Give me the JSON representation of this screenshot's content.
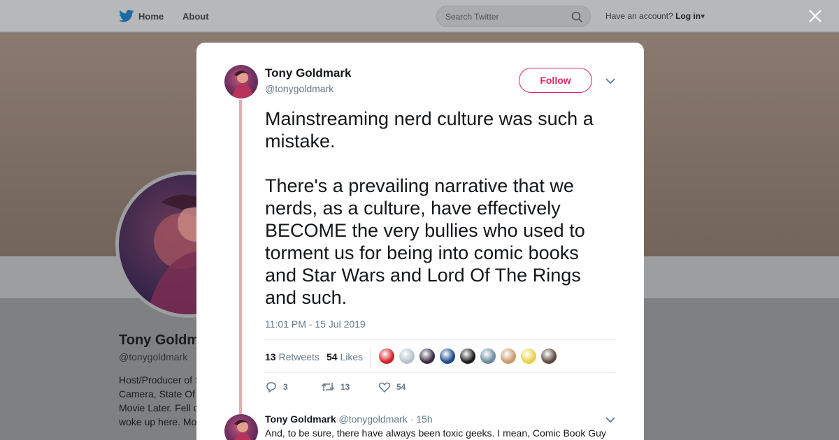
{
  "nav": {
    "home": "Home",
    "about": "About",
    "search_placeholder": "Search Twitter",
    "account_prompt": "Have an account?",
    "login": "Log in"
  },
  "background_profile": {
    "name": "Tony Goldm",
    "handle": "@tonygoldmark",
    "bio_lines": [
      "Host/Producer of S",
      "Camera, State Of",
      "Movie Later. Fell c",
      "woke up here. Mo"
    ]
  },
  "tweet": {
    "name": "Tony Goldmark",
    "handle": "@tonygoldmark",
    "follow_label": "Follow",
    "text": "Mainstreaming nerd culture was such a mistake.\n\nThere's a prevailing narrative that we nerds, as a culture, have effectively BECOME the very bullies who used to torment us for being into comic books and Star Wars and Lord Of The Rings and such.",
    "timestamp": "11:01 PM - 15 Jul 2019",
    "retweets_count": "13",
    "retweets_label": "Retweets",
    "likes_count": "54",
    "likes_label": "Likes",
    "likers": [
      {
        "color": "#d11f26",
        "icon": "red-triangle-logo"
      },
      {
        "color": "#b8c2cc",
        "icon": "default-person"
      },
      {
        "color": "#3a2a40",
        "icon": "person-dark-hair"
      },
      {
        "color": "#1d4a8a",
        "icon": "blue-art"
      },
      {
        "color": "#1a1a1a",
        "icon": "dark-figure"
      },
      {
        "color": "#6a8aa0",
        "icon": "landscape"
      },
      {
        "color": "#c79a6a",
        "icon": "cartoon-face"
      },
      {
        "color": "#e9d04a",
        "icon": "yellow-character"
      },
      {
        "color": "#5a4a3e",
        "icon": "bearded-man"
      }
    ],
    "actions": {
      "replies": "3",
      "retweets": "13",
      "likes": "54"
    }
  },
  "reply": {
    "name": "Tony Goldmark",
    "handle": "@tonygoldmark",
    "time": "· 15h",
    "text": "And, to be sure, there have always been toxic geeks. I mean, Comic Book Guy"
  },
  "colors": {
    "accent": "#e0245e",
    "thread_line": "#f0a5b4",
    "twitter_blue": "#1da1f2"
  }
}
